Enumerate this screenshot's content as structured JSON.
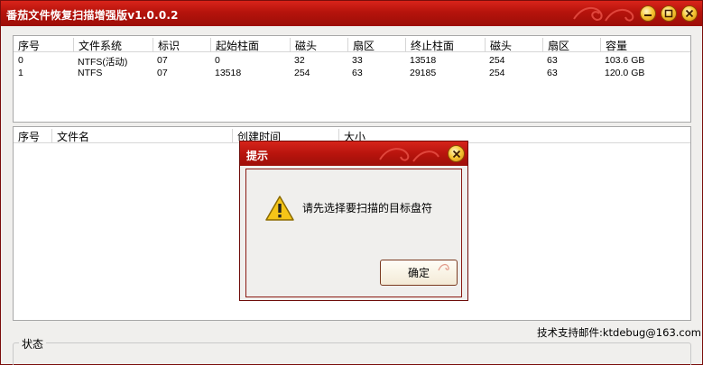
{
  "window": {
    "title": "番茄文件恢复扫描增强版v1.0.0.2",
    "accent_color": "#b5130c",
    "buttons": [
      "minimize-icon",
      "maximize-icon",
      "close-icon"
    ]
  },
  "drive_list": {
    "columns": [
      "序号",
      "文件系统",
      "标识",
      "起始柱面",
      "磁头",
      "扇区",
      "终止柱面",
      "磁头",
      "扇区",
      "容量"
    ],
    "rows": [
      [
        "0",
        "NTFS(活动)",
        "07",
        "0",
        "32",
        "33",
        "13518",
        "254",
        "63",
        "103.6 GB"
      ],
      [
        "1",
        "NTFS",
        "07",
        "13518",
        "254",
        "63",
        "29185",
        "254",
        "63",
        "120.0 GB"
      ]
    ]
  },
  "file_list": {
    "columns": [
      "序号",
      "文件名",
      "创建时间",
      "大小"
    ]
  },
  "footer": {
    "support": "技术支持邮件:ktdebug@163.com",
    "status_label": "状态"
  },
  "dialog": {
    "title": "提示",
    "message": "请先选择要扫描的目标盘符",
    "ok_label": "确定",
    "icon": "warning-icon"
  }
}
